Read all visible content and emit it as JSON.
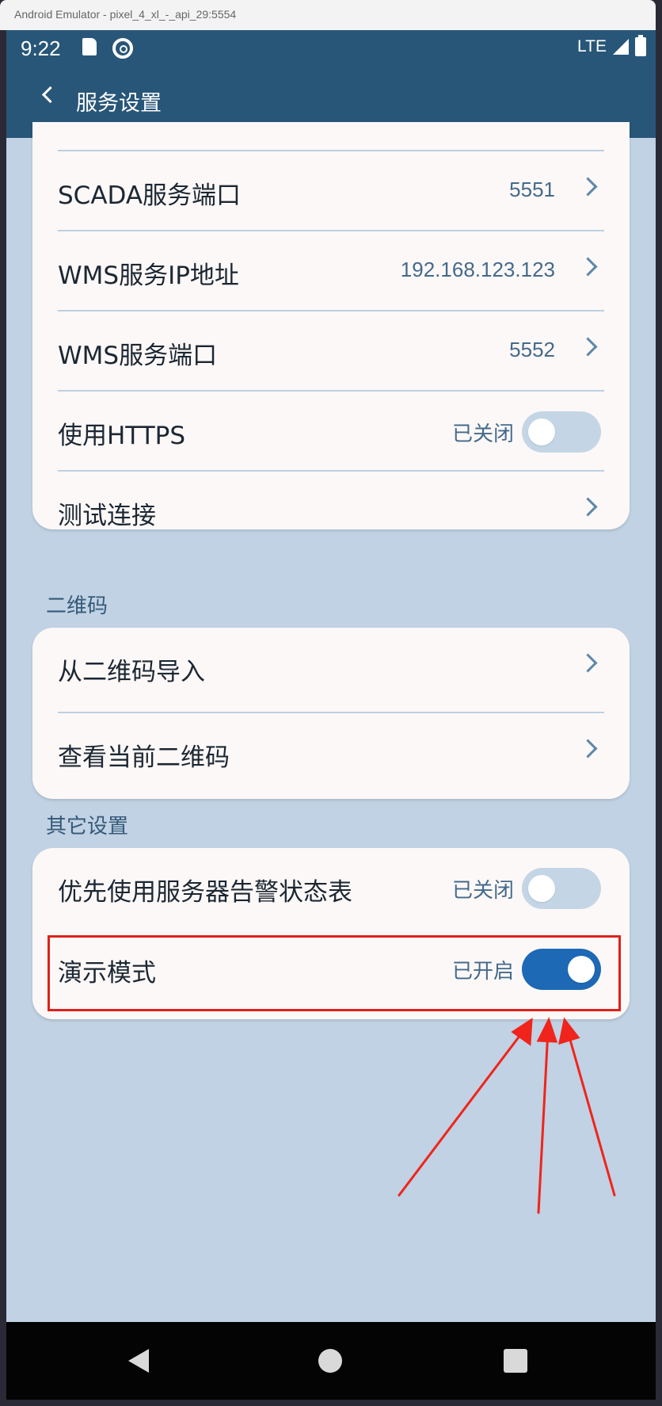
{
  "window": {
    "title": "Android Emulator - pixel_4_xl_-_api_29:5554"
  },
  "status_bar": {
    "time": "9:22",
    "network": "LTE"
  },
  "app_bar": {
    "title": "服务设置"
  },
  "server_card": {
    "rows": [
      {
        "label": "SCADA服务端口",
        "value": "5551"
      },
      {
        "label": "WMS服务IP地址",
        "value": "192.168.123.123"
      },
      {
        "label": "WMS服务端口",
        "value": "5552"
      },
      {
        "label": "使用HTTPS",
        "state": "已关闭",
        "toggle": false
      },
      {
        "label": "测试连接"
      }
    ]
  },
  "qr_section": {
    "header": "二维码",
    "rows": [
      {
        "label": "从二维码导入"
      },
      {
        "label": "查看当前二维码"
      }
    ]
  },
  "other_section": {
    "header": "其它设置",
    "rows": [
      {
        "label": "优先使用服务器告警状态表",
        "state": "已关闭",
        "toggle": false
      },
      {
        "label": "演示模式",
        "state": "已开启",
        "toggle": true
      }
    ]
  },
  "colors": {
    "app_bar": "#285678",
    "background": "#c0d2e3",
    "card": "#fcf8f7",
    "toggle_on": "#1d69b5",
    "toggle_off": "#c4d6e6",
    "annotation": "#e0201b"
  },
  "icons": [
    "sd-card-icon",
    "sync-icon",
    "signal-icon",
    "battery-icon",
    "back-arrow-icon",
    "chevron-right-icon",
    "nav-back-icon",
    "nav-home-icon",
    "nav-recents-icon"
  ]
}
